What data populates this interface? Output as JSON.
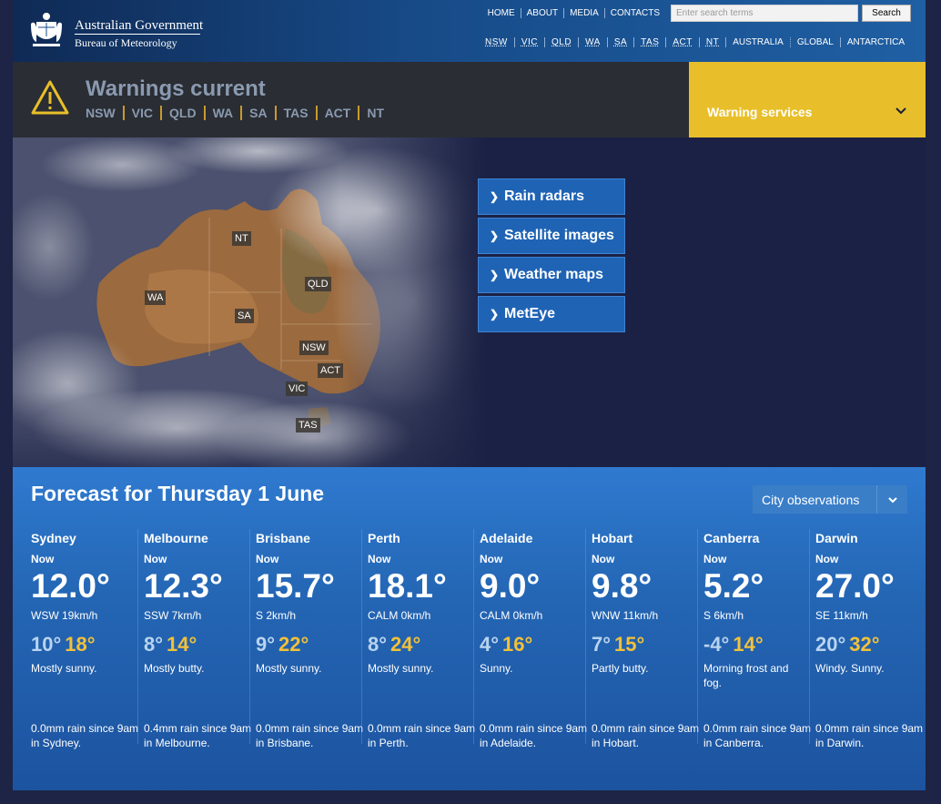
{
  "header": {
    "gov_name": "Australian Government",
    "agency_name": "Bureau of Meteorology",
    "top_links": [
      "HOME",
      "ABOUT",
      "MEDIA",
      "CONTACTS"
    ],
    "search_placeholder": "Enter search terms",
    "search_button": "Search",
    "state_links": [
      "NSW",
      "VIC",
      "QLD",
      "WA",
      "SA",
      "TAS",
      "ACT",
      "NT"
    ],
    "region_links": [
      "AUSTRALIA",
      "GLOBAL",
      "ANTARCTICA"
    ]
  },
  "warnings": {
    "title": "Warnings current",
    "states": [
      "NSW",
      "VIC",
      "QLD",
      "WA",
      "SA",
      "TAS",
      "ACT",
      "NT"
    ],
    "services_label": "Warning services"
  },
  "map": {
    "labels": [
      "NT",
      "WA",
      "QLD",
      "SA",
      "NSW",
      "ACT",
      "VIC",
      "TAS"
    ],
    "quick_links": [
      "Rain radars",
      "Satellite images",
      "Weather maps",
      "MetEye"
    ]
  },
  "forecast": {
    "title": "Forecast for Thursday 1 June",
    "city_obs_label": "City observations",
    "now_label": "Now",
    "cities": [
      {
        "name": "Sydney",
        "temp": "12.0°",
        "wind": "WSW 19km/h",
        "min": "10°",
        "max": "18°",
        "desc": "Mostly sunny.",
        "rain": "0.0mm rain since 9am in Sydney."
      },
      {
        "name": "Melbourne",
        "temp": "12.3°",
        "wind": "SSW 7km/h",
        "min": "8°",
        "max": "14°",
        "desc": "Mostly butty.",
        "rain": "0.4mm rain since 9am in Melbourne."
      },
      {
        "name": "Brisbane",
        "temp": "15.7°",
        "wind": "S 2km/h",
        "min": "9°",
        "max": "22°",
        "desc": "Mostly sunny.",
        "rain": "0.0mm rain since 9am in Brisbane."
      },
      {
        "name": "Perth",
        "temp": "18.1°",
        "wind": "CALM 0km/h",
        "min": "8°",
        "max": "24°",
        "desc": "Mostly sunny.",
        "rain": "0.0mm rain since 9am in Perth."
      },
      {
        "name": "Adelaide",
        "temp": "9.0°",
        "wind": "CALM 0km/h",
        "min": "4°",
        "max": "16°",
        "desc": "Sunny.",
        "rain": "0.0mm rain since 9am in Adelaide."
      },
      {
        "name": "Hobart",
        "temp": "9.8°",
        "wind": "WNW 11km/h",
        "min": "7°",
        "max": "15°",
        "desc": "Partly butty.",
        "rain": "0.0mm rain since 9am in Hobart."
      },
      {
        "name": "Canberra",
        "temp": "5.2°",
        "wind": "S 6km/h",
        "min": "-4°",
        "max": "14°",
        "desc": "Morning frost and fog.",
        "rain": "0.0mm rain since 9am in Canberra."
      },
      {
        "name": "Darwin",
        "temp": "27.0°",
        "wind": "SE 11km/h",
        "min": "20°",
        "max": "32°",
        "desc": "Windy. Sunny.",
        "rain": "0.0mm rain since 9am in Darwin."
      }
    ]
  },
  "colors": {
    "accent_yellow": "#e8bf2a",
    "max_temp": "#f2c13a",
    "min_temp": "#b9d4ef",
    "link_blue": "#1f63b5"
  }
}
